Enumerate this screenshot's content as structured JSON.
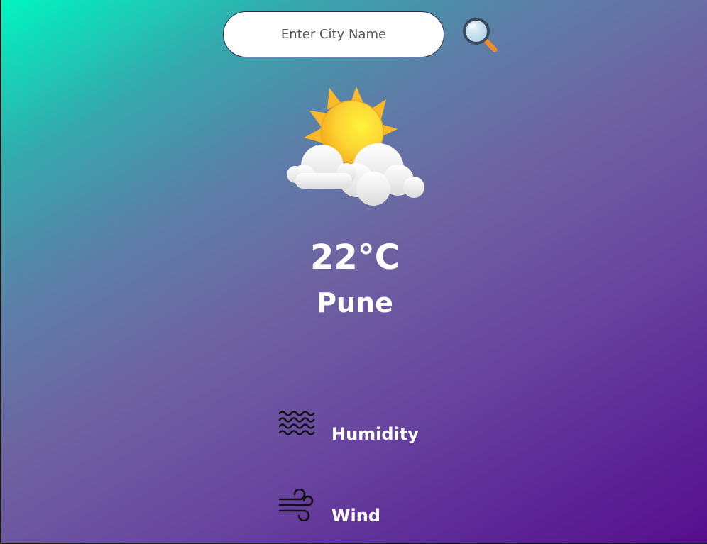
{
  "search": {
    "placeholder": "Enter City Name",
    "icon": "magnifying-glass-icon"
  },
  "weather": {
    "icon": "partly-cloudy-sun-icon",
    "temperature": "22°C",
    "city": "Pune"
  },
  "details": {
    "humidity": {
      "icon": "waves-icon",
      "label": "Humidity"
    },
    "wind": {
      "icon": "wind-icon",
      "label": "Wind"
    }
  },
  "colors": {
    "gradient_start": "#00f5c0",
    "gradient_mid": "#6e64a2",
    "gradient_end": "#560e8e",
    "text": "#ffffff",
    "input_bg": "#ffffff",
    "sun": "#fcd535"
  }
}
